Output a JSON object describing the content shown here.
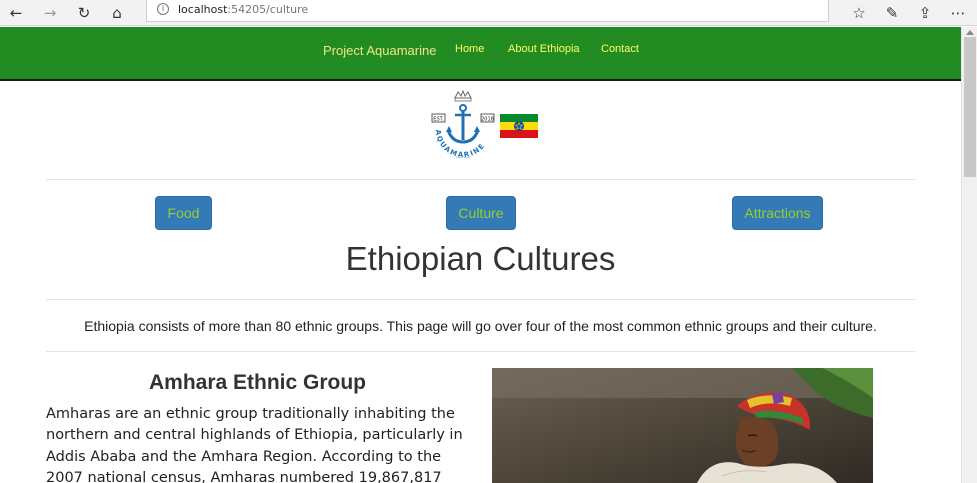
{
  "browser": {
    "url_host": "localhost",
    "url_path": ":54205/culture",
    "icons": [
      "back-icon",
      "forward-icon",
      "refresh-icon",
      "home-icon",
      "favorites-icon",
      "pen-icon",
      "share-icon",
      "more-icon"
    ]
  },
  "nav": {
    "brand": "Project Aquamarine",
    "links": [
      "Home",
      "About Ethiopia",
      "Contact"
    ]
  },
  "logo": {
    "est": "EST.",
    "year": "2018",
    "arc_text": "AQUAMARINE"
  },
  "buttons": {
    "food": "Food",
    "culture": "Culture",
    "attractions": "Attractions"
  },
  "page_title": "Ethiopian Cultures",
  "intro": "Ethiopia consists of more than 80 ethnic groups. This page will go over four of the most common ethnic groups and their culture.",
  "section": {
    "title": "Amhara Ethnic Group",
    "text": "Amharas are an ethnic group traditionally inhabiting the northern and central highlands of Ethiopia, particularly in Addis Ababa and the Amhara Region. According to the 2007 national census, Amharas numbered 19,867,817"
  },
  "colors": {
    "navbar": "#228b22",
    "brand": "#f0e68c",
    "nav_link": "#ffff66",
    "button_bg": "#337ab7",
    "button_text": "#9acd32"
  }
}
